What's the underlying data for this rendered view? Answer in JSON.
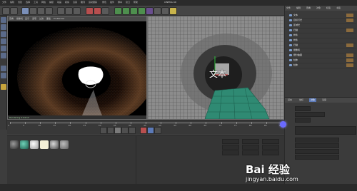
{
  "app": {
    "title": "CINEMA 4D"
  },
  "menus": [
    "文件",
    "编辑",
    "创建",
    "选择",
    "工具",
    "网格",
    "捕捉",
    "动画",
    "模拟",
    "渲染",
    "雕刻",
    "运动跟踪",
    "角色",
    "插件",
    "脚本",
    "窗口",
    "帮助"
  ],
  "viewport_left": {
    "header_items": [
      "查看",
      "摄像机",
      "显示",
      "选项",
      "过滤",
      "面板",
      "ProRender"
    ],
    "status": "Rendering 0:04:13"
  },
  "viewport_right": {
    "overlay_text": "文本"
  },
  "objects_panel": {
    "tabs": [
      "文件",
      "编辑",
      "查看",
      "对象",
      "标签",
      "书签"
    ],
    "items": [
      "文本",
      "目标灯光",
      "区域光",
      "扫描",
      "样条",
      "样条",
      "扫描",
      "摄像机",
      "细分曲面",
      "柱体",
      "柱体"
    ]
  },
  "attributes_panel": {
    "tabs": [
      "基本",
      "坐标",
      "对象",
      "渲染"
    ],
    "active_tab": "对象"
  },
  "timeline": {
    "ticks": [
      "0",
      "5",
      "10",
      "15",
      "20",
      "25",
      "30",
      "35",
      "40",
      "45",
      "50",
      "55",
      "60",
      "65",
      "70",
      "75",
      "80",
      "85",
      "90"
    ]
  },
  "transport_buttons": [
    "goto-start",
    "step-back",
    "play",
    "step-forward",
    "goto-end",
    "record",
    "key",
    "settings"
  ],
  "materials": [
    "mat-dark",
    "mat-teal",
    "mat-white",
    "mat-ivory",
    "mat-grey",
    "mat-silver"
  ],
  "watermark": {
    "logo": "Bai 经验",
    "url": "jingyan.baidu.com"
  },
  "colors": {
    "accent": "#5c7ab8",
    "vp_bg": "#000000",
    "mesh_green": "#2f8a73"
  }
}
